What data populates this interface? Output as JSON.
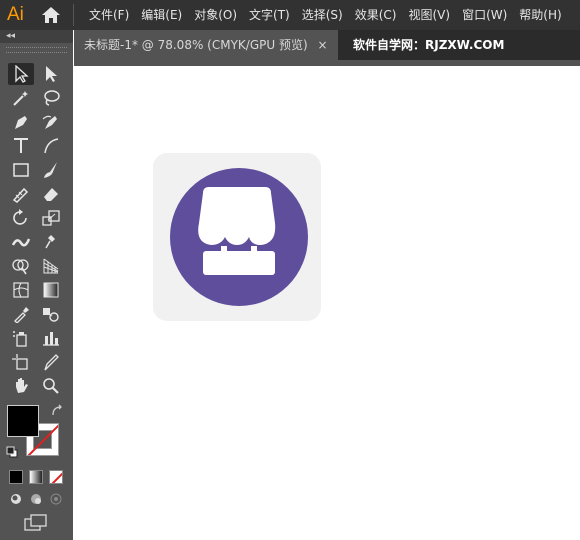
{
  "app": {
    "logo_text": "Ai",
    "brand_color": "#ff9a00"
  },
  "menu": {
    "items": [
      {
        "label": "文件(F)"
      },
      {
        "label": "编辑(E)"
      },
      {
        "label": "对象(O)"
      },
      {
        "label": "文字(T)"
      },
      {
        "label": "选择(S)"
      },
      {
        "label": "效果(C)"
      },
      {
        "label": "视图(V)"
      },
      {
        "label": "窗口(W)"
      },
      {
        "label": "帮助(H)"
      }
    ]
  },
  "tabs": {
    "active": {
      "label": "未标题-1* @ 78.08% (CMYK/GPU 预览)",
      "close": "×"
    },
    "second": {
      "label": "软件自学网：RJZXW.COM"
    }
  },
  "toolbar": {
    "collapse": "◂◂",
    "tools": [
      "selection-tool-icon",
      "direct-selection-tool-icon",
      "magic-wand-tool-icon",
      "lasso-tool-icon",
      "pen-tool-icon",
      "curvature-tool-icon",
      "type-tool-icon",
      "line-segment-tool-icon",
      "rectangle-tool-icon",
      "paintbrush-tool-icon",
      "shaper-tool-icon",
      "eraser-tool-icon",
      "rotate-tool-icon",
      "scale-tool-icon",
      "width-tool-icon",
      "puppet-warp-tool-icon",
      "shape-builder-tool-icon",
      "perspective-grid-tool-icon",
      "mesh-tool-icon",
      "gradient-tool-icon",
      "eyedropper-tool-icon",
      "blend-tool-icon",
      "symbol-sprayer-tool-icon",
      "column-graph-tool-icon",
      "artboard-tool-icon",
      "slice-tool-icon",
      "hand-tool-icon",
      "zoom-tool-icon"
    ]
  },
  "colors": {
    "icon_purple": "#5f4e9c",
    "artboard_bg": "#f1f1f2",
    "fill": "#000000",
    "stroke": "none"
  }
}
